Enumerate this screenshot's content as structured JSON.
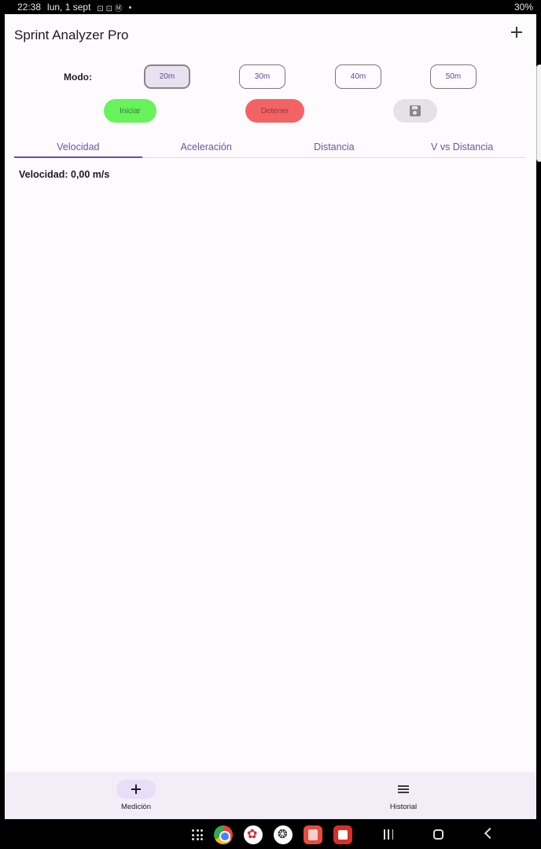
{
  "status_bar": {
    "time": "22:38",
    "date": "lun, 1 sept",
    "notification_icons": "⊡ ⊡ Ⓜ",
    "battery_text": "30%"
  },
  "app": {
    "title": "Sprint Analyzer Pro",
    "mode_label": "Modo:",
    "modes": [
      "20m",
      "30m",
      "40m",
      "50m"
    ],
    "selected_mode": "20m",
    "start_label": "Iniciar",
    "stop_label": "Detener",
    "tabs": [
      "Velocidad",
      "Aceleración",
      "Distancia",
      "V vs Distancia"
    ],
    "active_tab": "Velocidad",
    "velocity_text": "Velocidad: 0,00 m/s"
  },
  "bottom_nav": {
    "items": [
      "Medición",
      "Historial"
    ]
  },
  "colors": {
    "start": "#66f35c",
    "stop": "#f46363",
    "accent": "#6750a4",
    "nav_bg": "#f2edf7"
  }
}
